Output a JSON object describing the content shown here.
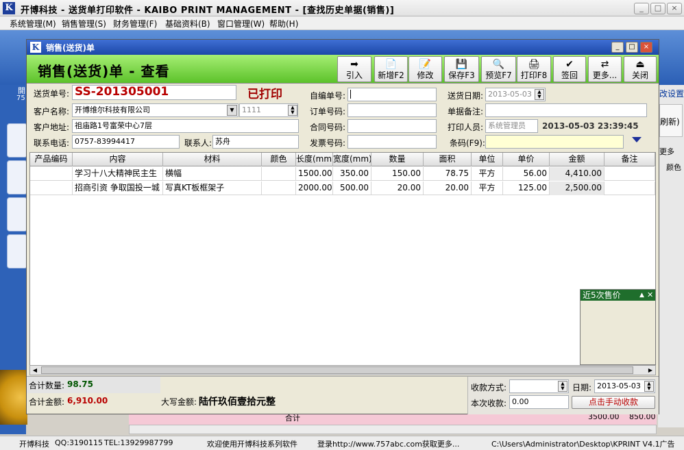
{
  "window": {
    "title": "开博科技 - 送货单打印软件 - KAIBO PRINT MANAGEMENT - [查找历史单据(销售)]",
    "logo": "K",
    "minimize": "_",
    "maximize": "□",
    "close": "×"
  },
  "menu": [
    "系统管理(M)",
    "销售管理(S)",
    "财务管理(F)",
    "基础资料(B)",
    "窗口管理(W)",
    "帮助(H)"
  ],
  "background": {
    "right_texts": [
      "改设置",
      "刷新)",
      "更多",
      "颜色"
    ],
    "left_texts": [
      "開",
      "75"
    ],
    "grid_cells": [
      "合计",
      "3500.00",
      "850.00"
    ]
  },
  "child_window": {
    "title": "销售(送货)单",
    "logo": "K"
  },
  "header": {
    "page_title": "销售(送货)单 - 查看",
    "buttons": [
      {
        "label": "引入",
        "icon": "import-arrow-icon",
        "glyph": "➡"
      },
      {
        "label": "新增F2",
        "icon": "new-document-icon",
        "glyph": "📄"
      },
      {
        "label": "修改",
        "icon": "edit-document-icon",
        "glyph": "📝"
      },
      {
        "label": "保存F3",
        "icon": "save-disk-icon",
        "glyph": "💾"
      },
      {
        "label": "预览F7",
        "icon": "preview-magnifier-icon",
        "glyph": "🔍"
      },
      {
        "label": "打印F8",
        "icon": "printer-icon",
        "glyph": "🖨"
      },
      {
        "label": "签回",
        "icon": "check-mark-icon",
        "glyph": "✔"
      },
      {
        "label": "更多...",
        "icon": "more-icon",
        "glyph": "⇄"
      },
      {
        "label": "关闭",
        "icon": "exit-door-icon",
        "glyph": "⏏"
      }
    ]
  },
  "form": {
    "bill_no_label": "送货单号:",
    "bill_no": "SS-201305001",
    "printed_flag": "已打印",
    "customer_label": "客户名称:",
    "customer": "开博维尔科技有限公司",
    "customer_code": "1111",
    "address_label": "客户地址:",
    "address": "祖庙路1号富荣中心7层",
    "phone_label": "联系电话:",
    "phone": "0757-83994417",
    "contact_label": "联系人:",
    "contact": "苏舟",
    "self_no_label": "自编单号:",
    "self_no": "",
    "order_no_label": "订单号码:",
    "order_no": "",
    "contract_no_label": "合同号码:",
    "contract_no": "",
    "invoice_no_label": "发票号码:",
    "invoice_no": "",
    "delivery_date_label": "送货日期:",
    "delivery_date": "2013-05-03",
    "remark_label": "单据备注:",
    "remark": "",
    "printer_label": "打印人员:",
    "printer": "系统管理员",
    "print_time": "2013-05-03 23:39:45",
    "barcode_label": "条码(F9):",
    "barcode": ""
  },
  "grid": {
    "columns": [
      "产品编码",
      "内容",
      "材料",
      "颜色",
      "长度(mm)",
      "宽度(mm)",
      "数量",
      "面积",
      "单位",
      "单价",
      "金额",
      "备注"
    ],
    "rows": [
      [
        "",
        "学习十八大精神民主生",
        "横幅",
        "",
        "1500.00",
        "350.00",
        "150.00",
        "78.75",
        "平方",
        "56.00",
        "4,410.00",
        ""
      ],
      [
        "",
        "招商引资 争取国投一城",
        "写真KT板框架子",
        "",
        "2000.00",
        "500.00",
        "20.00",
        "20.00",
        "平方",
        "125.00",
        "2,500.00",
        ""
      ]
    ]
  },
  "price_panel": {
    "title": "近5次售价"
  },
  "footer": {
    "total_qty_label": "合计数量:",
    "total_qty": "98.75",
    "total_amt_label": "合计金额:",
    "total_amt": "6,910.00",
    "capital_label": "大写金额:",
    "capital": "陆仟玖佰壹拾元整",
    "payment_method_label": "收款方式:",
    "payment_method": "",
    "date_label": "日期:",
    "date": "2013-05-03",
    "received_label": "本次收款:",
    "received": "0.00",
    "manual_button": "点击手动收款"
  },
  "statusbar": {
    "company": "开博科技",
    "qq": "QQ:3190115",
    "tel": "TEL:13929987799",
    "welcome": "欢迎使用开博科技系列软件",
    "login": "登录http://www.757abc.com获取更多...",
    "path": "C:\\Users\\Administrator\\Desktop\\KPRINT V4.1广告"
  }
}
